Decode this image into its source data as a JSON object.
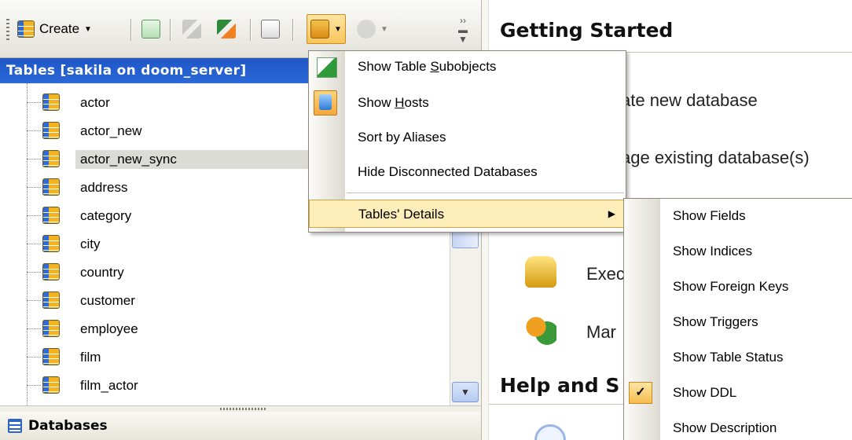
{
  "toolbar": {
    "create_label": "Create"
  },
  "left_panel": {
    "title": "Tables [sakila on doom_server]",
    "tables": [
      "actor",
      "actor_new",
      "actor_new_sync",
      "address",
      "category",
      "city",
      "country",
      "customer",
      "employee",
      "film",
      "film_actor"
    ],
    "selected": "actor_new_sync",
    "databases_label": "Databases"
  },
  "right_pane": {
    "getting_started": "Getting Started",
    "create_db_fragment": "ate new database",
    "manage_db_fragment": "age existing database(s)",
    "exec_fragment": "Exec",
    "man_fragment": "Mar",
    "help_fragment": "Help and S"
  },
  "view_menu": {
    "show_table_subobjects": {
      "pre": "Show Table ",
      "key": "S",
      "post": "ubobjects"
    },
    "show_hosts": {
      "pre": "Show ",
      "key": "H",
      "post": "osts"
    },
    "sort_by_aliases": "Sort by Aliases",
    "hide_disconnected": "Hide Disconnected Databases",
    "tables_details": "Tables' Details"
  },
  "details_menu": {
    "items": [
      "Show Fields",
      "Show Indices",
      "Show Foreign Keys",
      "Show Triggers",
      "Show Table Status",
      "Show DDL",
      "Show Description"
    ],
    "checked": "Show DDL"
  },
  "colors": {
    "header_blue": "#2b68d8",
    "highlight": "#fdedb8"
  }
}
